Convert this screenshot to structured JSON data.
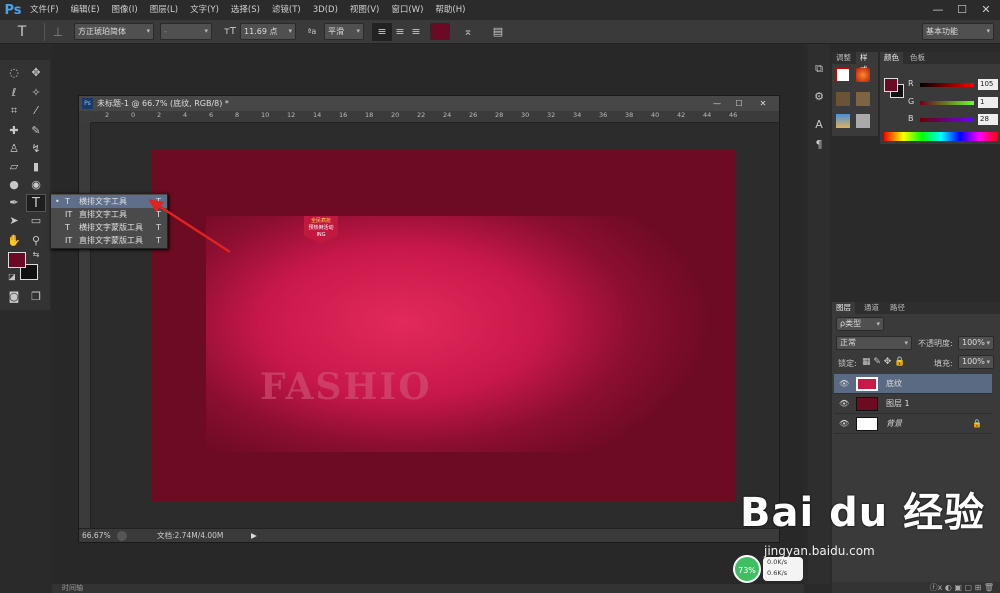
{
  "app": {
    "logo": "Ps"
  },
  "menu": [
    "文件(F)",
    "编辑(E)",
    "图像(I)",
    "图层(L)",
    "文字(Y)",
    "选择(S)",
    "滤镜(T)",
    "3D(D)",
    "视图(V)",
    "窗口(W)",
    "帮助(H)"
  ],
  "window_controls": {
    "minimize": "—",
    "maximize": "☐",
    "close": "✕"
  },
  "options_bar": {
    "tool_icon": "T",
    "font_family": "方正琥珀简体",
    "font_style": "-",
    "font_size": "11.69 点",
    "aa_label": "ªa",
    "anti_alias": "平滑",
    "workspace": "基本功能",
    "text_color": "#6b0a24"
  },
  "document": {
    "title": "未标题-1 @ 66.7% (底纹, RGB/8) *",
    "ruler_top": [
      "2",
      "0",
      "2",
      "4",
      "6",
      "8",
      "10",
      "12",
      "14",
      "16",
      "18",
      "20",
      "22",
      "24",
      "26",
      "28",
      "30",
      "32",
      "34",
      "36",
      "38",
      "40",
      "42",
      "44",
      "46"
    ],
    "zoom": "66.67%",
    "doc_size": "文档:2.74M/4.00M",
    "fashion_text": "FASHIO",
    "badge_lines": [
      "全民疯抢",
      "预热倒活动",
      "ING"
    ]
  },
  "flyout": {
    "items": [
      {
        "marker": "•",
        "icon": "T",
        "label": "横排文字工具",
        "key": "T",
        "selected": true
      },
      {
        "marker": "",
        "icon": "IT",
        "label": "直排文字工具",
        "key": "T",
        "selected": false
      },
      {
        "marker": "",
        "icon": "T",
        "label": "横排文字蒙版工具",
        "key": "T",
        "selected": false
      },
      {
        "marker": "",
        "icon": "IT",
        "label": "直排文字蒙版工具",
        "key": "T",
        "selected": false
      }
    ]
  },
  "swatch_tabs": [
    "调整",
    "样式"
  ],
  "color_panel": {
    "tabs": [
      "颜色",
      "色板"
    ],
    "fg_color": "#6b0a24",
    "r": "105",
    "g": "1",
    "b": "28",
    "r_label": "R",
    "g_label": "G",
    "b_label": "B"
  },
  "layers_panel": {
    "tabs": [
      "图层",
      "通道",
      "路径"
    ],
    "filter": "ρ类型",
    "blend_mode": "正常",
    "opacity_label": "不透明度:",
    "opacity": "100%",
    "lock_label": "锁定:",
    "fill_label": "填充:",
    "fill": "100%",
    "layers": [
      {
        "name": "底纹",
        "selected": true,
        "thumb": "#c8194a"
      },
      {
        "name": "图层 1",
        "selected": false,
        "thumb": "#6d0b22"
      },
      {
        "name": "背景",
        "selected": false,
        "thumb": "#ffffff",
        "locked": true
      }
    ]
  },
  "watermark": {
    "logo": "Bai du 经验",
    "url": "jingyan.baidu.com"
  },
  "network": {
    "percent": "73%",
    "up": "0.0K/s",
    "down": "0.6K/s",
    "label": "免费WiFi"
  },
  "timeline": {
    "label": "时间轴"
  }
}
